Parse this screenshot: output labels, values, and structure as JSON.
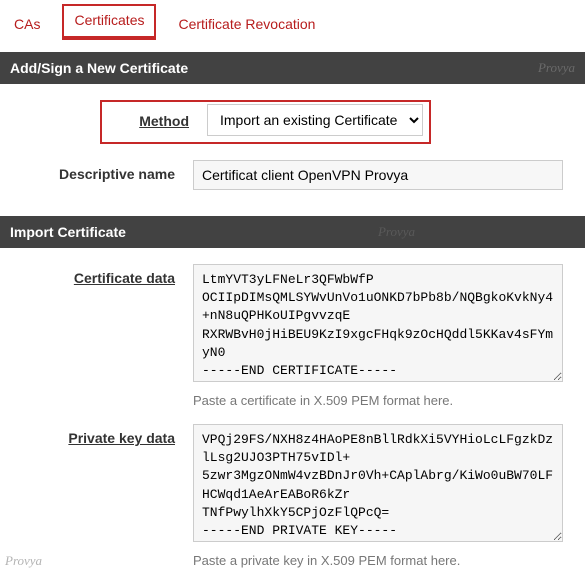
{
  "tabs": {
    "cas": "CAs",
    "certificates": "Certificates",
    "revocation": "Certificate Revocation"
  },
  "panel1": {
    "title": "Add/Sign a New Certificate",
    "watermark": "Provya",
    "method_label": "Method",
    "method_value": "Import an existing Certificate",
    "name_label": "Descriptive name",
    "name_value": "Certificat client OpenVPN Provya"
  },
  "panel2": {
    "title": "Import Certificate",
    "watermark": "Provya",
    "cert_label": "Certificate data",
    "cert_value": "LtmYVT3yLFNeLr3QFWbWfP\nOCIIpDIMsQMLSYWvUnVo1uONKD7bPb8b/NQBgkoKvkNy4+nN8uQPHKoUIPgvvzqE\nRXRWBvH0jHiBEU9KzI9xgcFHqk9zOcHQddl5KKav4sFYmyN0\n-----END CERTIFICATE-----",
    "cert_help": "Paste a certificate in X.509 PEM format here.",
    "key_label": "Private key data",
    "key_value": "VPQj29FS/NXH8z4HAoPE8nBllRdkXi5VYHioLcLFgzkDzlLsg2UJO3PTH75vIDl+\n5zwr3MgzONmW4vzBDnJr0Vh+CAplAbrg/KiWo0uBW70LFHCWqd1AeArEABoR6kZr\nTNfPwylhXkY5CPjOzFlQPcQ=\n-----END PRIVATE KEY-----",
    "key_help": "Paste a private key in X.509 PEM format here.",
    "footer_watermark": "Provya"
  }
}
